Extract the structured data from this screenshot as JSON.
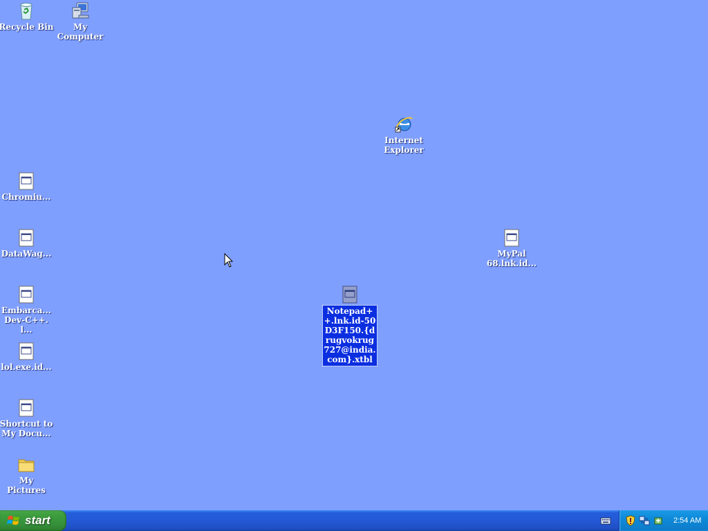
{
  "desktop": {
    "icons": [
      {
        "label": "Recycle Bin",
        "icon": "recycle-bin-icon"
      },
      {
        "label": "My\nComputer",
        "icon": "my-computer-icon"
      },
      {
        "label": "Internet\nExplorer",
        "icon": "internet-explorer-icon"
      },
      {
        "label": "Chromiu...",
        "icon": "shortcut-file-icon"
      },
      {
        "label": "DataWag...",
        "icon": "shortcut-file-icon"
      },
      {
        "label": "Embarca...\nDev-C++.l...",
        "icon": "shortcut-file-icon"
      },
      {
        "label": "lol.exe.id...",
        "icon": "shortcut-file-icon"
      },
      {
        "label": "Shortcut to\nMy Docu...",
        "icon": "shortcut-file-icon"
      },
      {
        "label": "My\nPictures",
        "icon": "folder-icon"
      },
      {
        "label": "MyPal\n68.lnk.id...",
        "icon": "shortcut-file-icon"
      },
      {
        "label": "Notepad++.lnk.id-50D3F150.{drugvokrug727@india.com}.xtbl",
        "icon": "shortcut-file-icon",
        "selected": true
      }
    ]
  },
  "taskbar": {
    "start_label": "start",
    "clock": "2:54 AM",
    "tray_icons": [
      "security-shield-icon",
      "network-icon",
      "safely-remove-icon"
    ]
  },
  "colors": {
    "desktop_background": "#7f9fff",
    "taskbar_blue": "#245edb",
    "start_green": "#3c9b3c",
    "selection_blue": "#0b2ee0"
  }
}
